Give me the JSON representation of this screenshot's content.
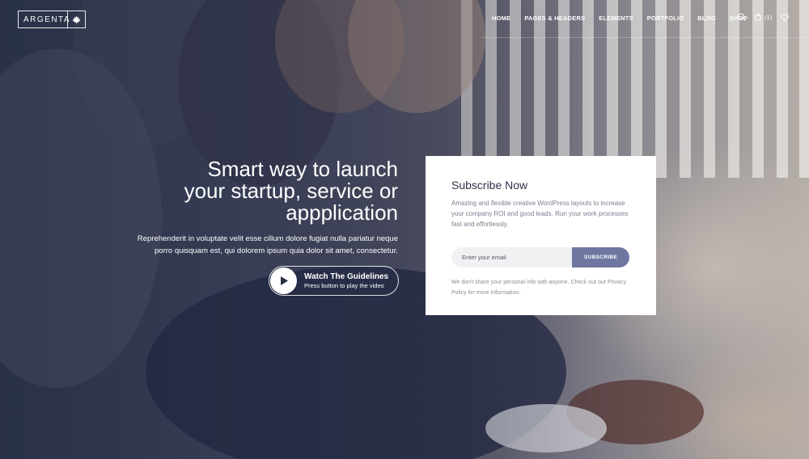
{
  "header": {
    "logo_text": "ARGENTA",
    "nav_items": [
      "HOME",
      "PAGES & HEADERS",
      "ELEMENTS",
      "PORTFOLIO",
      "BLOG",
      "SHOP"
    ],
    "cart_count": "(1)",
    "icons": [
      "search-icon",
      "cart-icon",
      "heart-icon"
    ]
  },
  "hero": {
    "title_lines": [
      "Smart way to launch",
      "your startup, service or",
      "appplication"
    ],
    "text": "Reprehenderit in voluptate velit esse cillum dolore fugiat nulla pariatur neque porro quisquam est, qui dolorem ipsum quia dolor sit amet, consectetur.",
    "watch_title": "Watch The Guidelines",
    "watch_subtitle": "Press button to play the video"
  },
  "subscribe": {
    "title": "Subscribe Now",
    "description": "Amazing and flexible creative WordPress layouts to increase your company ROI and good leads. Run your work processes fast and effortlessly.",
    "email_placeholder": "Enter your email",
    "button_label": "SUBSCRIBE",
    "note": "We don't share your personal info with anyone. Check out our Privacy Policy for more information."
  },
  "colors": {
    "accent": "#6f77a1",
    "title": "#2e3348",
    "overlay": "#1c223a"
  }
}
